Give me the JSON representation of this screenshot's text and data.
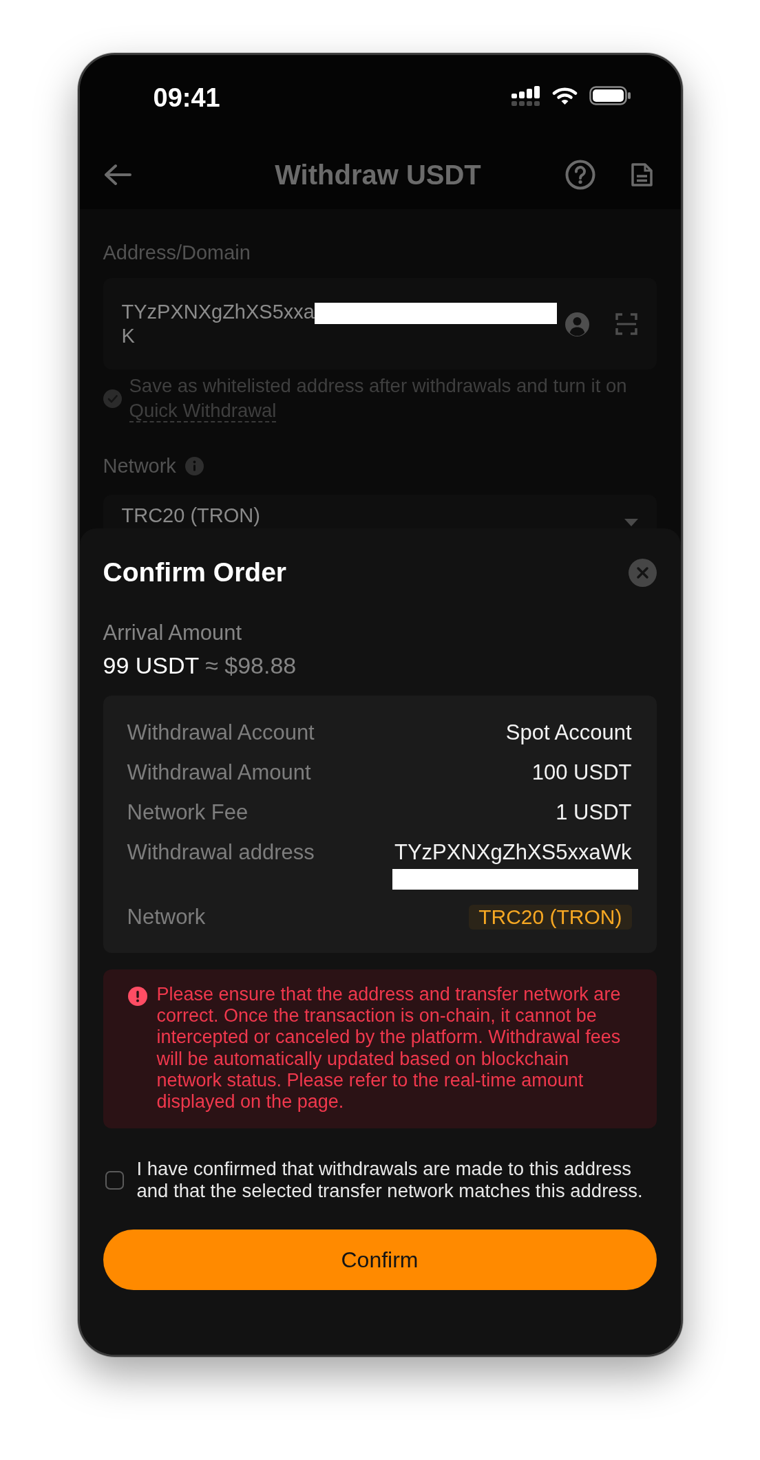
{
  "status_bar": {
    "time": "09:41"
  },
  "header": {
    "title": "Withdraw USDT"
  },
  "address": {
    "label": "Address/Domain",
    "value_start": "TYzPXNXgZhXS5xxa",
    "redacted": true,
    "value_end": "K"
  },
  "whitelist": {
    "checked": true,
    "text": "Save as whitelisted address after withdrawals and turn it on",
    "link": "Quick Withdrawal"
  },
  "network": {
    "label": "Network",
    "value": "TRC20 (TRON)"
  },
  "confirm_sheet": {
    "title": "Confirm Order",
    "arrival_label": "Arrival Amount",
    "arrival_amount": "99 USDT",
    "arrival_fiat": "≈ $98.88",
    "details": [
      {
        "kind": "text",
        "label": "Withdrawal Account",
        "value": "Spot Account"
      },
      {
        "kind": "text",
        "label": "Withdrawal Amount",
        "value": "100 USDT"
      },
      {
        "kind": "text",
        "label": "Network Fee",
        "value": "1 USDT"
      },
      {
        "kind": "address",
        "label": "Withdrawal address",
        "value": "TYzPXNXgZhXS5xxaWk",
        "redacted": true
      },
      {
        "kind": "badge",
        "label": "Network",
        "value": "TRC20 (TRON)"
      }
    ],
    "warning": "Please ensure that the address and transfer network are correct. Once the transaction is on-chain, it cannot be intercepted or canceled by the platform. Withdrawal fees will be automatically updated based on blockchain network status. Please refer to the real-time amount displayed on the page.",
    "agreement": {
      "checked": false,
      "text": "I have confirmed that withdrawals are made to this address and that the selected transfer network matches this address."
    },
    "button": "Confirm"
  }
}
